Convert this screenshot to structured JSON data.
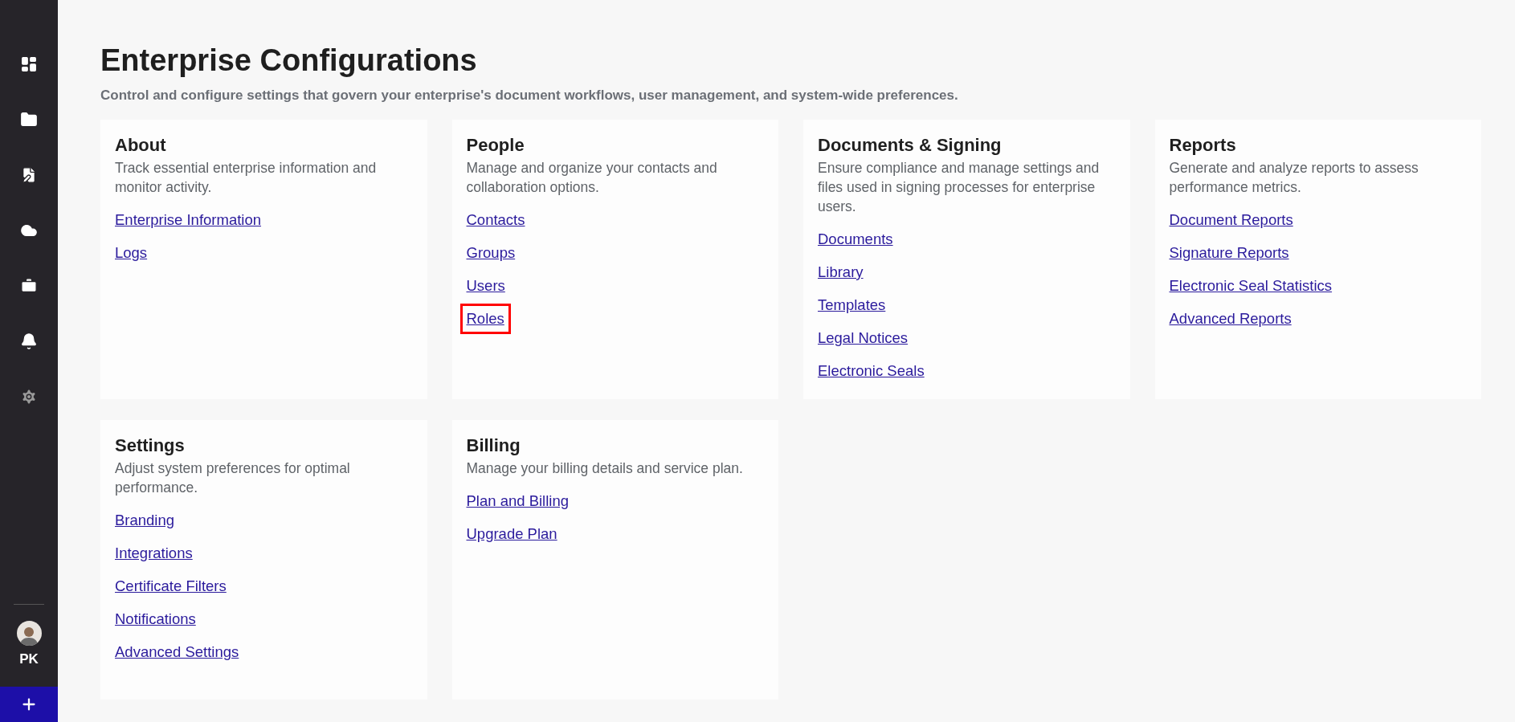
{
  "sidebar": {
    "nav": [
      {
        "kind": "dashboard"
      },
      {
        "kind": "folder"
      },
      {
        "kind": "document"
      },
      {
        "kind": "cloud"
      },
      {
        "kind": "briefcase"
      },
      {
        "kind": "bell"
      },
      {
        "kind": "settings"
      }
    ],
    "user": {
      "initials": "PK"
    }
  },
  "header": {
    "title": "Enterprise Configurations",
    "subtitle": "Control and configure settings that govern your enterprise's document workflows, user management, and system-wide preferences."
  },
  "cards": [
    {
      "title": "About",
      "description": "Track essential enterprise information and monitor activity.",
      "links": [
        {
          "label": "Enterprise Information",
          "highlighted": false
        },
        {
          "label": "Logs",
          "highlighted": false
        }
      ]
    },
    {
      "title": "People",
      "description": "Manage and organize your contacts and collaboration options.",
      "links": [
        {
          "label": "Contacts",
          "highlighted": false
        },
        {
          "label": "Groups",
          "highlighted": false
        },
        {
          "label": "Users",
          "highlighted": false
        },
        {
          "label": "Roles",
          "highlighted": true
        }
      ]
    },
    {
      "title": "Documents & Signing",
      "description": "Ensure compliance and manage settings and files used in signing processes for enterprise users.",
      "links": [
        {
          "label": "Documents",
          "highlighted": false
        },
        {
          "label": "Library",
          "highlighted": false
        },
        {
          "label": "Templates",
          "highlighted": false
        },
        {
          "label": "Legal Notices",
          "highlighted": false
        },
        {
          "label": "Electronic Seals",
          "highlighted": false
        }
      ]
    },
    {
      "title": "Reports",
      "description": "Generate and analyze reports to assess performance metrics.",
      "links": [
        {
          "label": "Document Reports",
          "highlighted": false
        },
        {
          "label": "Signature Reports",
          "highlighted": false
        },
        {
          "label": "Electronic Seal Statistics",
          "highlighted": false
        },
        {
          "label": "Advanced Reports",
          "highlighted": false
        }
      ]
    },
    {
      "title": "Settings",
      "description": "Adjust system preferences for optimal performance.",
      "links": [
        {
          "label": "Branding",
          "highlighted": false
        },
        {
          "label": "Integrations",
          "highlighted": false
        },
        {
          "label": "Certificate Filters",
          "highlighted": false
        },
        {
          "label": "Notifications",
          "highlighted": false
        },
        {
          "label": "Advanced Settings",
          "highlighted": false
        }
      ]
    },
    {
      "title": "Billing",
      "description": "Manage your billing details and service plan.",
      "links": [
        {
          "label": "Plan and Billing",
          "highlighted": false
        },
        {
          "label": "Upgrade Plan",
          "highlighted": false
        }
      ]
    }
  ]
}
